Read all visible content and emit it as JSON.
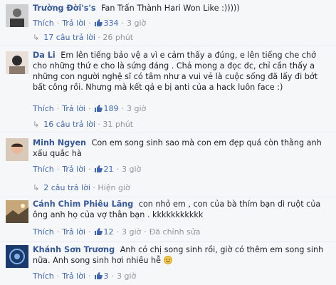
{
  "comments": [
    {
      "name": "Trường Đời's's",
      "text": "Fan Trấn Thành Hari Won Like :)))))",
      "action_reply": "Thích · Trả lời",
      "like_label": "Thích",
      "reply_label": "Trả lời",
      "likes": "334",
      "time": "3 giờ",
      "replies_label": "17 câu trả lời",
      "replies_time": "26 phút"
    },
    {
      "name": "Da Li",
      "text": "Em lên tiếng bảo vệ a vì e cảm thấy a đúng, e lên tiếng che chở cho những thứ e cho là sứng đáng . Chả mong a đọc đc, chỉ cần thấy a những con người nghệ sĩ có tâm như a vui vẻ là cuộc sống đã lấy đi bớt bất công rồi. Nhưng mà kết qả e bị anti của a hack luôn face :)",
      "like_label": "Thích",
      "reply_label": "Trả lời",
      "likes": "189",
      "time": "3 giờ",
      "replies_label": "16 câu trả lời",
      "replies_time": "31 phút"
    },
    {
      "name": "Minh Ngyen",
      "text": "Con em song sinh sao mà con em đẹp quá còn thằng anh xấu quắc hà",
      "like_label": "Thích",
      "reply_label": "Trả lời",
      "likes": "21",
      "time": "3 giờ",
      "replies_label": "2 câu trả lời",
      "replies_time": "Hiện giờ"
    },
    {
      "name": "Cánh Chim Phiêu Lãng",
      "text": "con nhỏ em , con của bà thím bạn dì ruột của ông anh họ của vợ thằn bạn . kkkkkkkkkkk",
      "like_label": "Thích",
      "reply_label": "Trả lời",
      "likes": "12",
      "time": "3 giờ",
      "edited": "Đã chỉnh sửa"
    },
    {
      "name": "Khánh Sơn Trương",
      "text": "Anh có chị song sinh rồi, giờ có thêm em song sinh nữa. Anh song sinh hơi nhiều hễ",
      "like_label": "Thích",
      "reply_label": "Trả lời",
      "likes": "3",
      "time": "3 giờ"
    }
  ],
  "colors": {
    "name": "#365899",
    "link": "#4267b2",
    "meta": "#90949c",
    "background": "#f6f7f9"
  }
}
